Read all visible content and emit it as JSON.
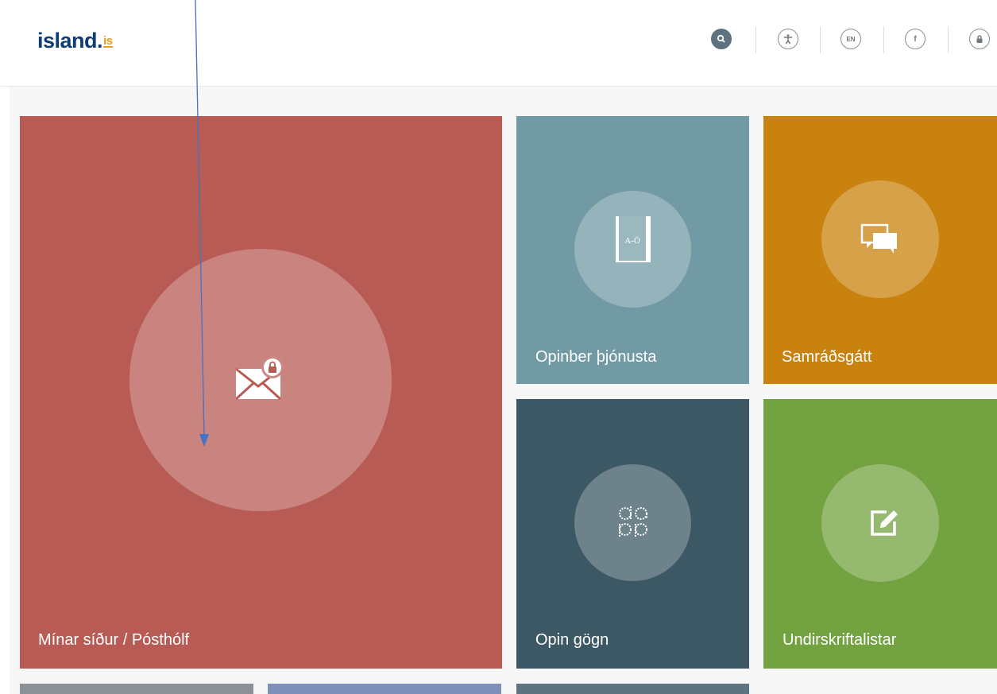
{
  "header": {
    "logo_text": "island.",
    "logo_tld": "is",
    "icons": [
      "search-icon",
      "accessibility-icon",
      "language-icon",
      "facebook-icon",
      "lock-icon"
    ],
    "search_label": "Q",
    "language_label": "EN",
    "facebook_label": "f"
  },
  "tiles": [
    {
      "label": "Mínar síður / Pósthólf",
      "icon": "mail-lock-icon",
      "color": "#b85b55"
    },
    {
      "label": "Opinber þjónusta",
      "icon": "book-icon",
      "icon_text": "A-Ö",
      "color": "#729aa4"
    },
    {
      "label": "Samráðsgátt",
      "icon": "chat-icon",
      "color": "#ca820e"
    },
    {
      "label": "Opin gögn",
      "icon": "open-data-icon",
      "color": "#3c5865"
    },
    {
      "label": "Undirskriftalistar",
      "icon": "edit-icon",
      "color": "#73a240"
    }
  ],
  "bottom_tiles_colors": [
    "#8b9196",
    "#7e8fb8",
    "#5d7480"
  ],
  "annotation_color": "#4472c4"
}
